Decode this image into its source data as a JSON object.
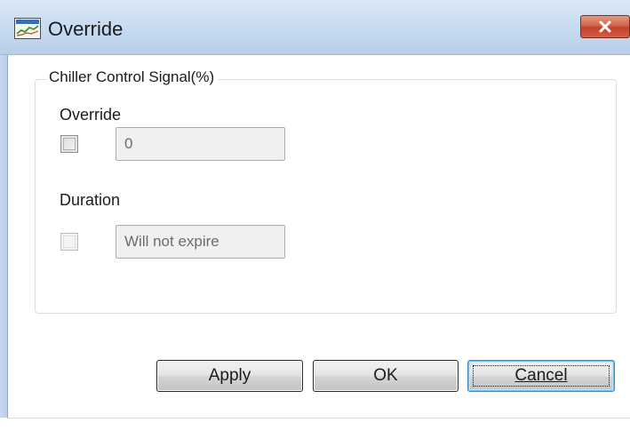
{
  "window": {
    "title": "Override",
    "icon": "chart-window-icon",
    "close_icon": "close-x-icon"
  },
  "group": {
    "title": "Chiller Control Signal(%)"
  },
  "override": {
    "label": "Override",
    "checked": false,
    "value": "0"
  },
  "duration": {
    "label": "Duration",
    "checked": false,
    "value": "Will not expire"
  },
  "buttons": {
    "apply": "Apply",
    "ok": "OK",
    "cancel": "Cancel"
  },
  "colors": {
    "close_button": "#c4402a",
    "titlebar": "#c9dcf1",
    "default_button_border": "#3b8cc7"
  }
}
